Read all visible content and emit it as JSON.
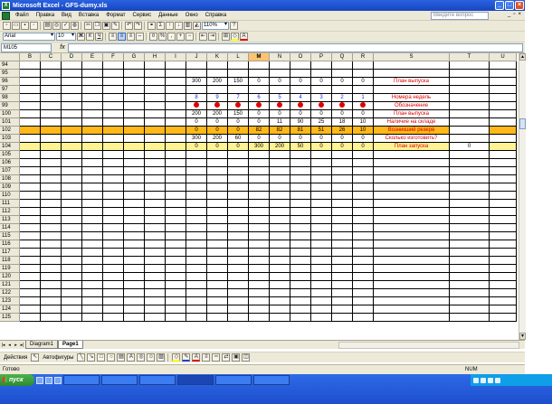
{
  "window": {
    "title": "Microsoft Excel - GFS-dumy.xls"
  },
  "menu": {
    "items": [
      "Файл",
      "Правка",
      "Вид",
      "Вставка",
      "Формат",
      "Сервис",
      "Данные",
      "Окно",
      "Справка"
    ],
    "help_placeholder": "Введите вопрос"
  },
  "toolbar": {
    "zoom": "110%",
    "font": "Arial",
    "size": "10"
  },
  "formula": {
    "name_box": "M105",
    "fx": "fx",
    "value": ""
  },
  "columns": [
    {
      "id": "B",
      "w": 23
    },
    {
      "id": "C",
      "w": 23
    },
    {
      "id": "D",
      "w": 23
    },
    {
      "id": "E",
      "w": 23
    },
    {
      "id": "F",
      "w": 23
    },
    {
      "id": "G",
      "w": 23
    },
    {
      "id": "H",
      "w": 23
    },
    {
      "id": "I",
      "w": 23
    },
    {
      "id": "J",
      "w": 23
    },
    {
      "id": "K",
      "w": 23
    },
    {
      "id": "L",
      "w": 23
    },
    {
      "id": "M",
      "w": 23
    },
    {
      "id": "N",
      "w": 23
    },
    {
      "id": "O",
      "w": 23
    },
    {
      "id": "P",
      "w": 23
    },
    {
      "id": "Q",
      "w": 23
    },
    {
      "id": "R",
      "w": 23
    },
    {
      "id": "S",
      "w": 84
    },
    {
      "id": "T",
      "w": 44
    },
    {
      "id": "U",
      "w": 30
    }
  ],
  "selected_column": "M",
  "rows": [
    {
      "n": "94",
      "cells": {}
    },
    {
      "n": "95",
      "cells": {}
    },
    {
      "n": "96",
      "cells": {
        "J": "300",
        "K": "200",
        "L": "150",
        "M": "0",
        "N": "0",
        "O": "0",
        "P": "0",
        "Q": "0",
        "R": "0",
        "S": "План выпуска"
      },
      "s_color": "red"
    },
    {
      "n": "97",
      "cells": {}
    },
    {
      "n": "98",
      "cells": {
        "J": "8",
        "K": "9",
        "L": "7",
        "M": "6",
        "N": "5",
        "O": "4",
        "P": "3",
        "Q": "2",
        "R": "1",
        "S": "Номера недель"
      },
      "s_color": "red",
      "num_color": "blue"
    },
    {
      "n": "99",
      "cells": {
        "S": "Обозначение"
      },
      "dots": true,
      "s_color": "red"
    },
    {
      "n": "100",
      "cells": {
        "J": "200",
        "K": "200",
        "L": "150",
        "M": "0",
        "N": "0",
        "O": "0",
        "P": "0",
        "Q": "0",
        "R": "0",
        "S": "План выпуска"
      },
      "s_color": "red"
    },
    {
      "n": "101",
      "cells": {
        "J": "0",
        "K": "0",
        "L": "0",
        "M": "0",
        "N": "11",
        "O": "90",
        "P": "25",
        "Q": "18",
        "R": "10",
        "S": "Наличие на складе"
      },
      "s_color": "red"
    },
    {
      "n": "102",
      "cells": {
        "J": "0",
        "K": "0",
        "L": "0",
        "M": "82",
        "N": "82",
        "O": "81",
        "P": "51",
        "Q": "26",
        "R": "10",
        "S": "Возникший резерв"
      },
      "s_color": "red",
      "style": "orange"
    },
    {
      "n": "103",
      "cells": {
        "J": "300",
        "K": "200",
        "L": "60",
        "M": "0",
        "N": "0",
        "O": "0",
        "P": "0",
        "Q": "0",
        "R": "0",
        "S": "Сколько изготовить?"
      },
      "s_color": "red"
    },
    {
      "n": "104",
      "cells": {
        "J": "0",
        "K": "0",
        "L": "0",
        "M": "300",
        "N": "200",
        "O": "50",
        "P": "0",
        "Q": "0",
        "R": "0",
        "S": "План запуска",
        "T": "0"
      },
      "s_color": "red",
      "style": "yellow"
    },
    {
      "n": "105",
      "cells": {}
    },
    {
      "n": "106",
      "cells": {}
    },
    {
      "n": "107",
      "cells": {}
    },
    {
      "n": "108",
      "cells": {}
    },
    {
      "n": "109",
      "cells": {}
    },
    {
      "n": "110",
      "cells": {}
    },
    {
      "n": "111",
      "cells": {}
    },
    {
      "n": "112",
      "cells": {}
    },
    {
      "n": "113",
      "cells": {}
    },
    {
      "n": "114",
      "cells": {}
    },
    {
      "n": "115",
      "cells": {}
    },
    {
      "n": "116",
      "cells": {}
    },
    {
      "n": "117",
      "cells": {}
    },
    {
      "n": "118",
      "cells": {}
    },
    {
      "n": "119",
      "cells": {}
    },
    {
      "n": "120",
      "cells": {}
    },
    {
      "n": "121",
      "cells": {}
    },
    {
      "n": "122",
      "cells": {}
    },
    {
      "n": "123",
      "cells": {}
    },
    {
      "n": "124",
      "cells": {}
    },
    {
      "n": "125",
      "cells": {}
    }
  ],
  "sheets": {
    "tabs": [
      "Diagram1",
      "Page1"
    ],
    "active": "Page1"
  },
  "draw": {
    "actions_label": "Действия",
    "autoshapes_label": "Автофигуры"
  },
  "status": {
    "left": "Готово",
    "num": "NUM"
  },
  "taskbar": {
    "start_label": "пуск"
  }
}
